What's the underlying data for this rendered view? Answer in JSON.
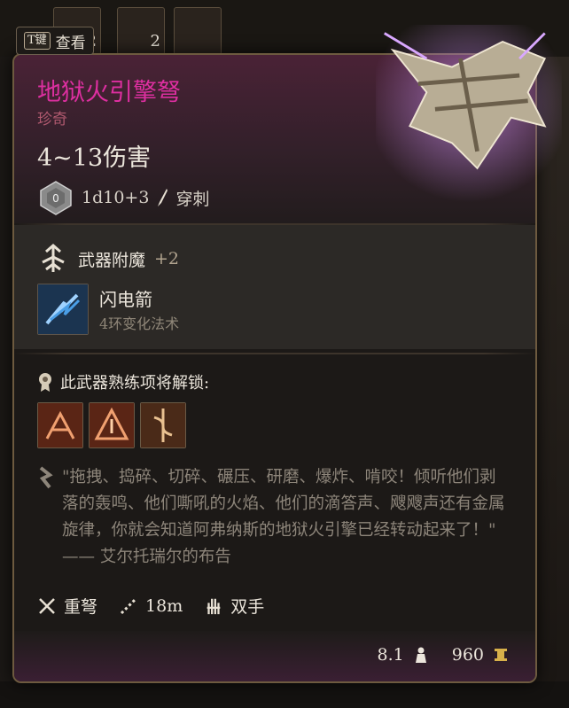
{
  "hint": {
    "key": "T键",
    "label": "查看"
  },
  "hotbar": [
    {
      "count": "2"
    },
    {
      "count": "2"
    }
  ],
  "item": {
    "name": "地狱火引擎弩",
    "rarity": "珍奇",
    "damage": "4~13伤害",
    "damage_formula": "1d10+3",
    "damage_type": "穿刺"
  },
  "enchantment": {
    "label": "武器附魔",
    "bonus": "+2"
  },
  "spell": {
    "name": "闪电箭",
    "subtitle": "4环变化法术"
  },
  "proficiency": {
    "label": "此武器熟练项将解锁:"
  },
  "flavor_text": "\"拖拽、捣碎、切碎、碾压、研磨、爆炸、啃咬！倾听他们剥落的轰鸣、他们嘶吼的火焰、他们的滴答声、飕飕声还有金属旋律，你就会知道阿弗纳斯的地狱火引擎已经转动起来了！\" —— 艾尔托瑞尔的布告",
  "properties": {
    "weapon_type": "重弩",
    "range": "18m",
    "handedness": "双手"
  },
  "footer": {
    "weight": "8.1",
    "value": "960"
  },
  "colors": {
    "item_name": "#dd2fa0",
    "rarity": "#b0596f",
    "accent_border": "#6d5a3f"
  },
  "icons": [
    "dice-icon",
    "piercing-icon",
    "weapon-enchant-icon",
    "lightning-bolt-spell-icon",
    "proficiency-medal-icon",
    "quote-icon",
    "heavy-crossbow-icon",
    "range-icon",
    "two-handed-icon",
    "weight-icon",
    "gold-icon"
  ]
}
